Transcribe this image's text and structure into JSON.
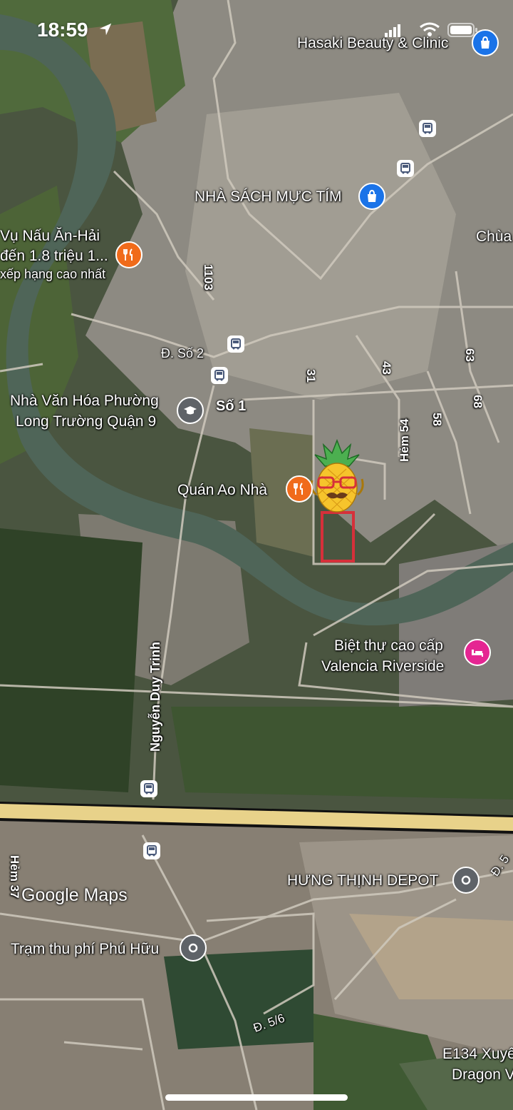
{
  "status_bar": {
    "time": "18:59"
  },
  "pois": {
    "hasaki": "Hasaki Beauty & Clinic",
    "nha_sach": "NHÀ SÁCH MỰC TÍM",
    "chua": "Chùa",
    "restaurant_line1": "Vụ Nấu Ăn-Hải",
    "restaurant_line2": "đến 1.8 triệu 1...",
    "restaurant_line3": "xếp hạng cao nhất",
    "nha_van_hoa_line1": "Nhà Văn Hóa Phường",
    "nha_van_hoa_line2": "Long Trường Quận 9",
    "quan_ao_nha": "Quán Ao Nhà",
    "valencia_line1": "Biệt thự cao cấp",
    "valencia_line2": "Valencia Riverside",
    "hung_thinh": "HƯNG THỊNH DEPOT",
    "tram_thu_phi": "Trạm thu phí Phú Hữu",
    "e134_line1": "E134 Xuyê",
    "e134_line2": "Dragon V"
  },
  "roads": {
    "r1103": "1103",
    "so2": "Đ. Số 2",
    "so1": "Số 1",
    "r31": "31",
    "r43": "43",
    "hem54": "Hẻm 54",
    "r58": "58",
    "r63": "63",
    "r68": "68",
    "nguyen_duy_trinh": "Nguyễn Duy Trinh",
    "hem37": "Hẻm 37",
    "d516": "Đ. 5/6",
    "d5": "Đ. 5"
  },
  "branding": {
    "google_maps": "Google Maps"
  },
  "colors": {
    "shopping_pin": "#1a73e8",
    "food_pin": "#f06b1b",
    "hotel_pin": "#e52592",
    "place_pin": "#5f6368",
    "highway": "#e8d28a",
    "river": "#4f6558",
    "marker_box": "#d6303a"
  },
  "icons": [
    "location-arrow-icon",
    "signal-icon",
    "wifi-icon",
    "battery-icon",
    "shopping-bag-icon",
    "bus-icon",
    "fork-knife-icon",
    "graduation-cap-icon",
    "bed-icon",
    "place-pin-icon",
    "pineapple-sticker-icon"
  ]
}
